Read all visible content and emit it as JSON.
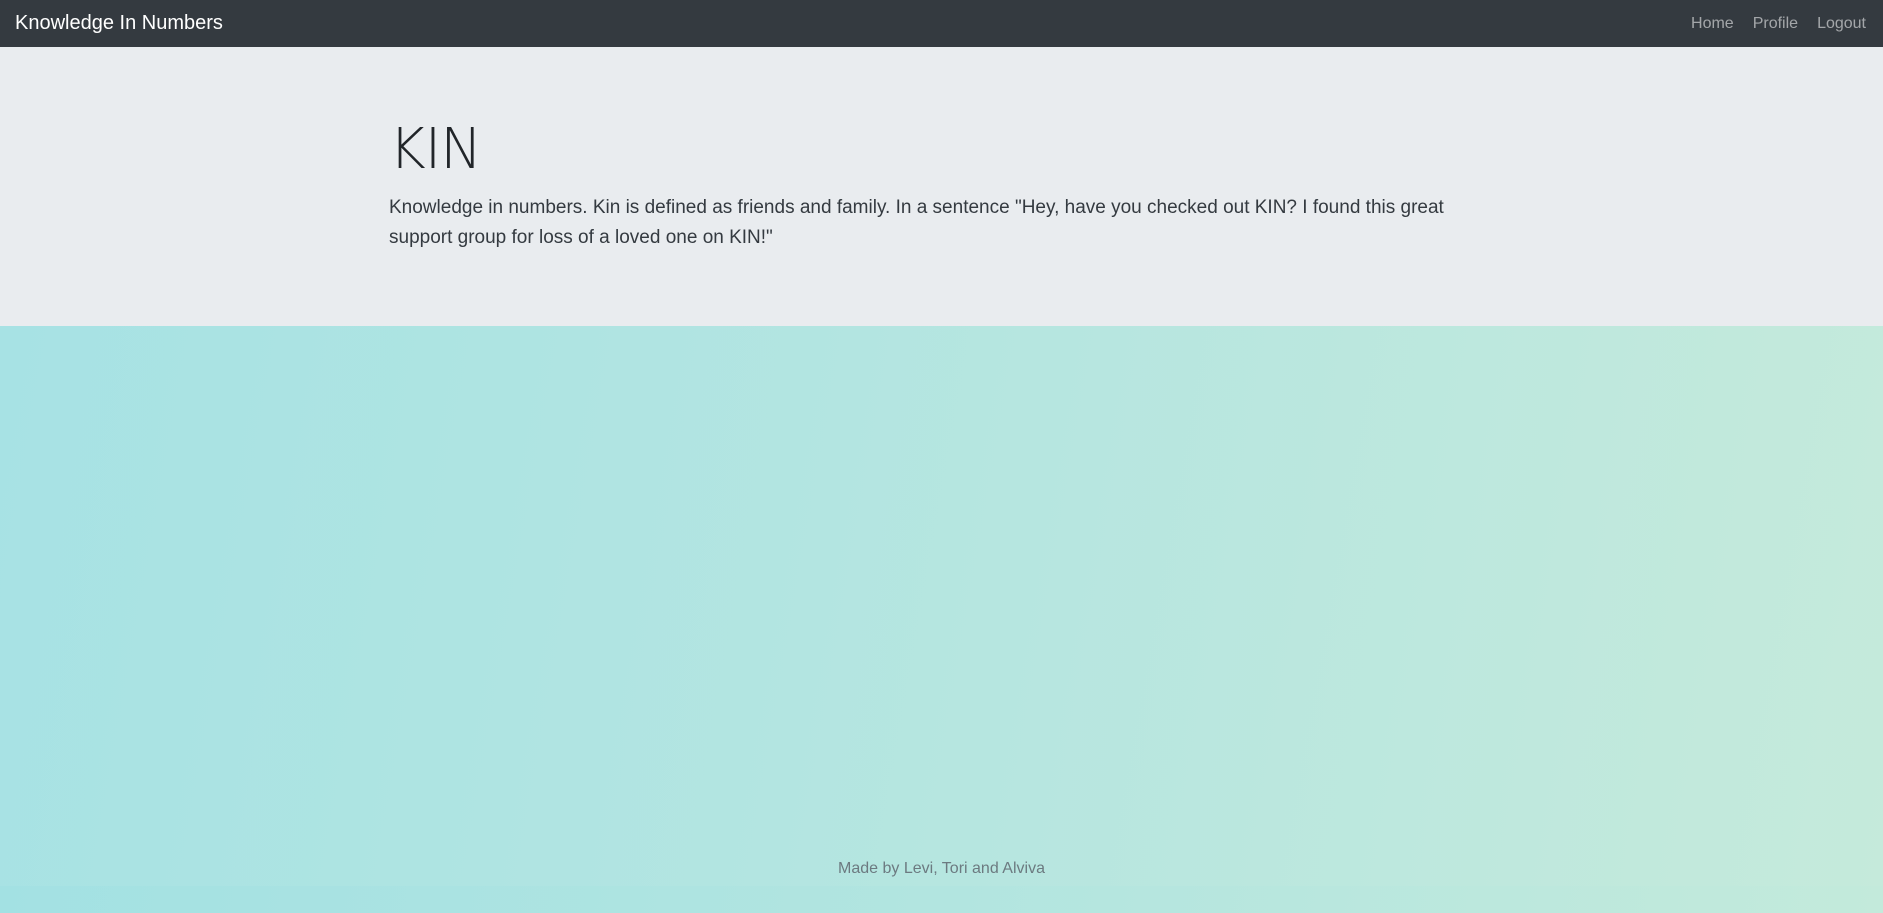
{
  "navbar": {
    "brand": "Knowledge In Numbers",
    "links": [
      {
        "label": "Home"
      },
      {
        "label": "Profile"
      },
      {
        "label": "Logout"
      }
    ],
    "background": "#343a40"
  },
  "jumbotron": {
    "title": "KIN",
    "lead": "Knowledge in numbers. Kin is defined as friends and family. In a sentence \"Hey, have you checked out KIN? I found this great support group for loss of a loved one on KIN!\"",
    "background": "#e9ecef"
  },
  "footer": {
    "text": "Made by Levi, Tori and Alviva"
  },
  "colors": {
    "gradient_start": "#a6e2e4",
    "gradient_end": "#c5eadb"
  }
}
